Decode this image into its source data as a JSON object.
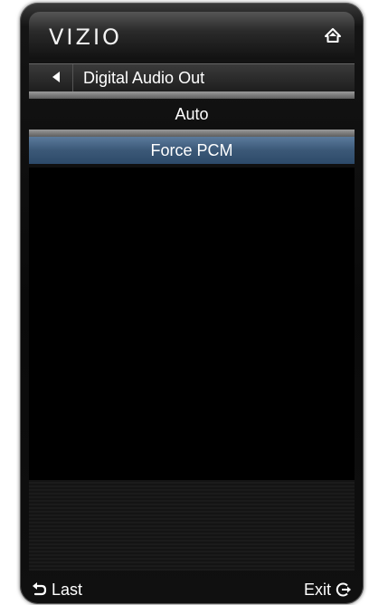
{
  "brand": {
    "logo_text": "VIZIO"
  },
  "icons": {
    "home": "home-icon",
    "back": "back-arrow-icon",
    "last": "return-arrow-icon",
    "exit": "exit-icon"
  },
  "menu": {
    "title": "Digital Audio Out",
    "options": [
      {
        "label": "Auto",
        "selected": false
      },
      {
        "label": "Force PCM",
        "selected": true
      }
    ]
  },
  "footer": {
    "last_label": "Last",
    "exit_label": "Exit"
  },
  "colors": {
    "selection": "#3b5877",
    "background": "#000000",
    "text": "#ffffff"
  }
}
